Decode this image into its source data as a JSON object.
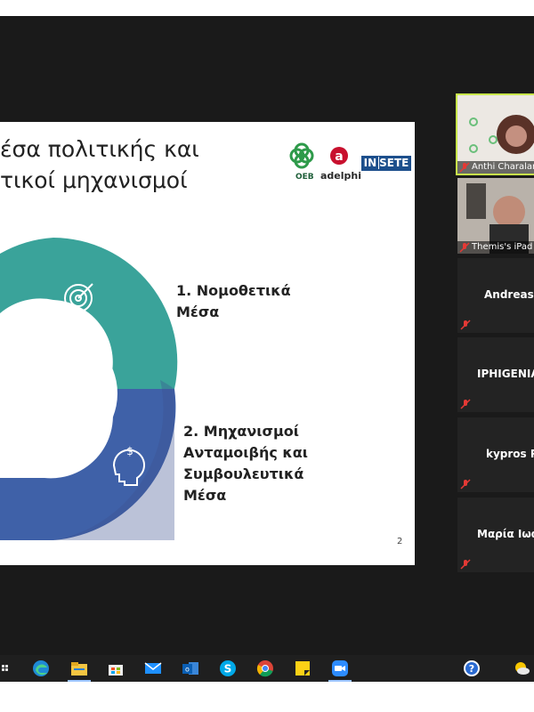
{
  "slide": {
    "title_line1": "έσα πολιτικής και",
    "title_line2": "τικοί μηχανισμοί",
    "logo_oeb": "OEB",
    "logo_adelphi": "adelphi",
    "logo_insete_in": "IN",
    "logo_insete_rest": "SETE",
    "item1": "1. Νομοθετικά Μέσα",
    "item2": "2. Μηχανισμοί Ανταμοιβής και Συμβουλευτικά Μέσα",
    "page_number": "2",
    "colors": {
      "teal": "#3aa39a",
      "dark_teal": "#2f6f86",
      "blue": "#3f61a8",
      "navy": "#3b4f8f"
    }
  },
  "participants": [
    {
      "name": "Anthi Charalamb",
      "video": true,
      "muted": true
    },
    {
      "name": "Themis's iPad",
      "video": true,
      "muted": true
    },
    {
      "name": "Andreas L",
      "video": false,
      "muted": true
    },
    {
      "name": "IPHIGENIA",
      "video": false,
      "muted": true
    },
    {
      "name": "kypros Pa",
      "video": false,
      "muted": true
    },
    {
      "name": "Μαρία Ιωα",
      "video": false,
      "muted": true
    }
  ],
  "taskbar": {
    "icons": [
      "start-partial-icon",
      "edge-icon",
      "file-explorer-icon",
      "store-icon",
      "mail-icon",
      "outlook-icon",
      "skype-icon",
      "chrome-icon",
      "sticky-notes-icon",
      "zoom-icon",
      "help-icon",
      "weather-icon"
    ],
    "left_glyph": "ꀀ"
  }
}
